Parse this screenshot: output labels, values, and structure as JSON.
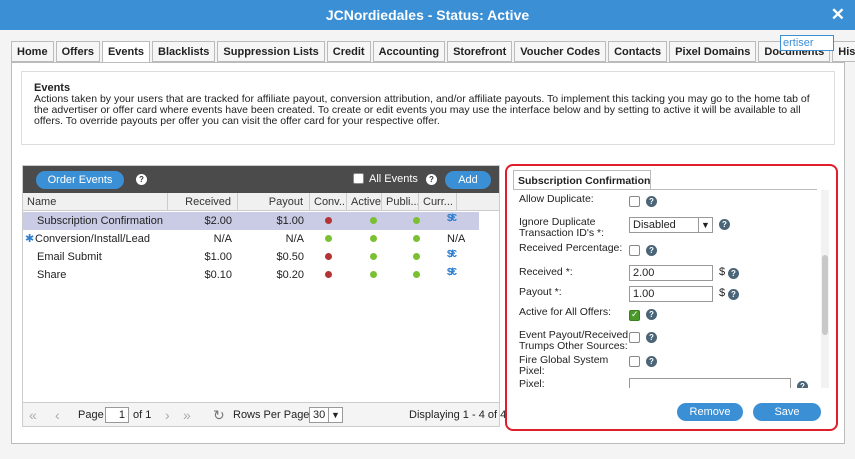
{
  "window": {
    "title": "JCNordiedales - Status: Active",
    "close_icon": "close-icon"
  },
  "advertiser_button": "ertiser",
  "tabs": [
    "Home",
    "Offers",
    "Events",
    "Blacklists",
    "Suppression Lists",
    "Credit",
    "Accounting",
    "Storefront",
    "Voucher Codes",
    "Contacts",
    "Pixel Domains",
    "Documents",
    "History"
  ],
  "active_tab": "Events",
  "description": {
    "heading": "Events",
    "text": "Actions taken by your users that are tracked for affiliate payout, conversion attribution, and/or affiliate payouts. To implement this tacking you may go to the home tab of the advertiser or offer card where events have been created. To create or edit events you may use the interface below and by setting to active it will be available to all offers. To override payouts per offer you can visit the offer card for your respective offer."
  },
  "grid": {
    "order_events_label": "Order Events",
    "all_events_label": "All Events",
    "add_label": "Add",
    "columns": [
      "Name",
      "Received",
      "Payout",
      "Conv...",
      "Active",
      "Publi...",
      "Curr..."
    ],
    "rows": [
      {
        "name": "Subscription Confirmation",
        "received": "$2.00",
        "payout": "$1.00",
        "conv": "red",
        "active": "green",
        "public": "green",
        "currency": "$/€",
        "selected": true,
        "marker": ""
      },
      {
        "name": "Conversion/Install/Lead",
        "received": "N/A",
        "payout": "N/A",
        "conv": "green",
        "active": "green",
        "public": "green",
        "currency": "N/A",
        "selected": false,
        "marker": "✱"
      },
      {
        "name": "Email Submit",
        "received": "$1.00",
        "payout": "$0.50",
        "conv": "red",
        "active": "green",
        "public": "green",
        "currency": "$/€",
        "selected": false,
        "marker": ""
      },
      {
        "name": "Share",
        "received": "$0.10",
        "payout": "$0.20",
        "conv": "red",
        "active": "green",
        "public": "green",
        "currency": "$/€",
        "selected": false,
        "marker": ""
      }
    ],
    "footer": {
      "page_label": "Page",
      "page_value": "1",
      "of_label": "of 1",
      "rows_per_page_label": "Rows Per Page:",
      "rows_per_page_value": "30",
      "displaying": "Displaying 1 - 4 of 4"
    }
  },
  "detail": {
    "tab_label": "Subscription Confirmation",
    "allow_duplicate_label": "Allow Duplicate:",
    "ignore_dup_label": "Ignore Duplicate Transaction ID's *:",
    "ignore_dup_value": "Disabled",
    "received_pct_label": "Received Percentage:",
    "received_label": "Received *:",
    "received_value": "2.00",
    "payout_label": "Payout *:",
    "payout_value": "1.00",
    "currency_symbol": "$",
    "active_all_label": "Active for All Offers:",
    "event_payout_label": "Event Payout/Received Trumps Other Sources:",
    "fire_pixel_label": "Fire Global System Pixel:",
    "pixel_label": "Pixel:",
    "pixel_value": "",
    "remove_label": "Remove",
    "save_label": "Save"
  },
  "colors": {
    "accent": "#3a8fd5",
    "highlight_border": "#e01e2b",
    "selected_row": "#c9cce4",
    "toolbar": "#4b4b4b"
  }
}
